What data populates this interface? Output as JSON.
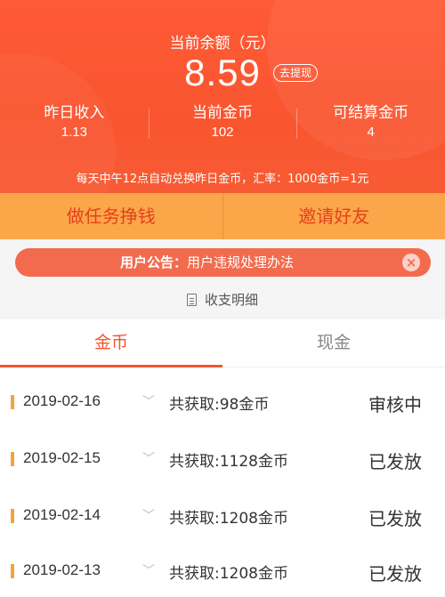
{
  "header": {
    "balance_label": "当前余额（元）",
    "balance_value": "8.59",
    "withdraw_label": "去提现",
    "stats": [
      {
        "label": "昨日收入",
        "value": "1.13"
      },
      {
        "label": "当前金币",
        "value": "102"
      },
      {
        "label": "可结算金币",
        "value": "4"
      }
    ],
    "exchange_notice": "每天中午12点自动兑换昨日金币，汇率：1000金币=1元"
  },
  "actions": {
    "tasks_label": "做任务挣钱",
    "invite_label": "邀请好友"
  },
  "announcement": {
    "title": "用户公告：",
    "text": "用户违规处理办法",
    "close_icon": "close-icon"
  },
  "detail_link": "收支明细",
  "tabs": [
    {
      "label": "金币",
      "active": true
    },
    {
      "label": "现金",
      "active": false
    }
  ],
  "records": [
    {
      "date": "2019-02-16",
      "desc": "共获取:98金币",
      "status": "审核中"
    },
    {
      "date": "2019-02-15",
      "desc": "共获取:1128金币",
      "status": "已发放"
    },
    {
      "date": "2019-02-14",
      "desc": "共获取:1208金币",
      "status": "已发放"
    },
    {
      "date": "2019-02-13",
      "desc": "共获取:1208金币",
      "status": "已发放"
    }
  ],
  "colors": {
    "accent": "#f3552f",
    "action_bar": "#fca64a",
    "bullet": "#f3a33c"
  }
}
